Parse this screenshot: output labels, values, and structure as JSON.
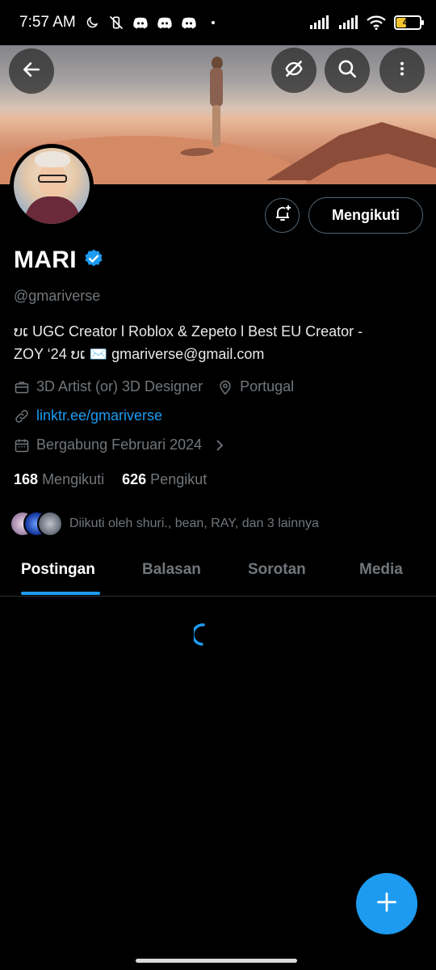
{
  "status_bar": {
    "time": "7:57 AM",
    "battery": "41"
  },
  "profile": {
    "name": "MARI",
    "verified": true,
    "handle": "@gmariverse",
    "bio_line1": "ບເ UGC Creator l Roblox & Zepeto l Best EU Creator -",
    "bio_line2": "ZOY ‘24 ບເ ✉️ gmariverse@gmail.com",
    "category": "3D Artist (or) 3D Designer",
    "location": "Portugal",
    "link": "linktr.ee/gmariverse",
    "joined": "Bergabung Februari 2024",
    "following_count": "168",
    "following_label": "Mengikuti",
    "followers_count": "626",
    "followers_label": "Pengikut",
    "followed_by": "Diikuti oleh shuri., bean, RAY, dan 3 lainnya"
  },
  "actions": {
    "follow_label": "Mengikuti"
  },
  "tabs": [
    {
      "label": "Postingan",
      "active": true
    },
    {
      "label": "Balasan",
      "active": false
    },
    {
      "label": "Sorotan",
      "active": false
    },
    {
      "label": "Media",
      "active": false
    }
  ],
  "colors": {
    "accent": "#1d9bf0",
    "muted": "#71767b",
    "background": "#000000"
  },
  "icons": {
    "back": "arrow-left-icon",
    "hide": "eye-slash-icon",
    "search": "search-icon",
    "more": "more-vertical-icon",
    "bell": "bell-plus-icon",
    "verified": "verified-badge-icon",
    "fab": "plus-icon"
  }
}
